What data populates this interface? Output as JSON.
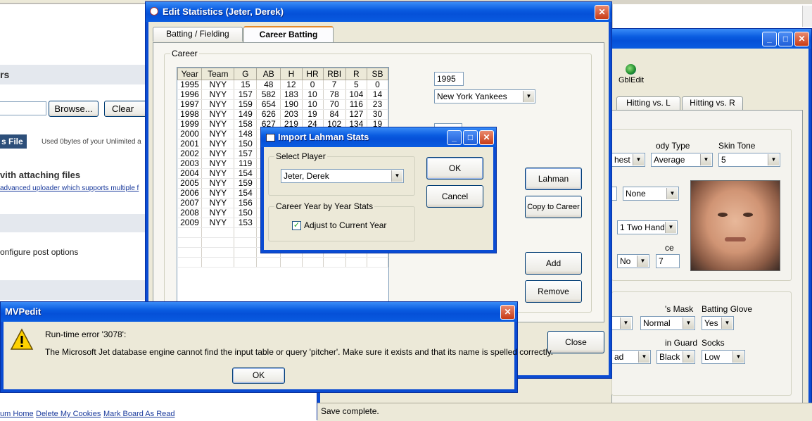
{
  "browser_bg": {
    "section_s": "rs",
    "browse_label": "Browse...",
    "clear_label": "Clear Se",
    "file_button": "s File",
    "used_text": "Used 0bytes of your Unlimited a",
    "attach_heading": "vith attaching files",
    "uploader_link": "advanced uploader which supports multiple f",
    "configure_text": "onfigure post options",
    "footer_links": [
      "um Home",
      "Delete My Cookies",
      "Mark Board As Read"
    ]
  },
  "back_window": {
    "gbl_label": "GblEdit",
    "tabs": [
      "Hitting vs. L",
      "Hitting vs. R"
    ],
    "labels": {
      "body_type": "ody Type",
      "skin_tone": "Skin Tone",
      "mask": "'s Mask",
      "batting_glove": "Batting Glove",
      "guard": "in Guard",
      "socks": "Socks",
      "ce": "ce"
    },
    "values": {
      "chest": "hest",
      "body_type": "Average",
      "skin_tone": "5",
      "none": "None",
      "hands": "1 Two Hands",
      "no": "No",
      "seven": "7",
      "empty1": "",
      "mask": "Normal",
      "glove": "Yes",
      "ad": "ad",
      "guard": "Black",
      "socks": "Low"
    },
    "status": "Save complete."
  },
  "edit_window": {
    "title": "Edit Statistics (Jeter, Derek)",
    "tabs": [
      "Batting / Fielding",
      "Career Batting"
    ],
    "career_label": "Career",
    "year_value": "1995",
    "team_value": "New York Yankees",
    "buttons": {
      "lahman": "Lahman",
      "copy": "Copy to Career",
      "add": "Add",
      "remove": "Remove",
      "close": "Close"
    },
    "columns": [
      "Year",
      "Team",
      "G",
      "AB",
      "H",
      "HR",
      "RBI",
      "R",
      "SB"
    ],
    "rows": [
      [
        "1995",
        "NYY",
        "15",
        "48",
        "12",
        "0",
        "7",
        "5",
        "0"
      ],
      [
        "1996",
        "NYY",
        "157",
        "582",
        "183",
        "10",
        "78",
        "104",
        "14"
      ],
      [
        "1997",
        "NYY",
        "159",
        "654",
        "190",
        "10",
        "70",
        "116",
        "23"
      ],
      [
        "1998",
        "NYY",
        "149",
        "626",
        "203",
        "19",
        "84",
        "127",
        "30"
      ],
      [
        "1999",
        "NYY",
        "158",
        "627",
        "219",
        "24",
        "102",
        "134",
        "19"
      ],
      [
        "2000",
        "NYY",
        "148",
        "",
        "",
        "",
        "",
        "",
        ""
      ],
      [
        "2001",
        "NYY",
        "150",
        "",
        "",
        "",
        "",
        "",
        ""
      ],
      [
        "2002",
        "NYY",
        "157",
        "",
        "",
        "",
        "",
        "",
        ""
      ],
      [
        "2003",
        "NYY",
        "119",
        "",
        "",
        "",
        "",
        "",
        ""
      ],
      [
        "2004",
        "NYY",
        "154",
        "",
        "",
        "",
        "",
        "",
        ""
      ],
      [
        "2005",
        "NYY",
        "159",
        "",
        "",
        "",
        "",
        "",
        ""
      ],
      [
        "2006",
        "NYY",
        "154",
        "",
        "",
        "",
        "",
        "",
        ""
      ],
      [
        "2007",
        "NYY",
        "156",
        "",
        "",
        "",
        "",
        "",
        ""
      ],
      [
        "2008",
        "NYY",
        "150",
        "",
        "",
        "",
        "",
        "",
        ""
      ],
      [
        "2009",
        "NYY",
        "153",
        "",
        "",
        "",
        "",
        "",
        ""
      ]
    ]
  },
  "import_dialog": {
    "title": "Import Lahman Stats",
    "select_player_label": "Select Player",
    "player_value": "Jeter, Derek",
    "career_year_label": "Career Year by Year Stats",
    "checkbox_label": "Adjust to Current Year",
    "ok": "OK",
    "cancel": "Cancel"
  },
  "error_dialog": {
    "title": "MVPedit",
    "line1": "Run-time error '3078':",
    "line2": "The Microsoft Jet database engine cannot find the input table or query 'pitcher'.  Make sure it exists and that its name is spelled correctly.",
    "ok": "OK"
  }
}
